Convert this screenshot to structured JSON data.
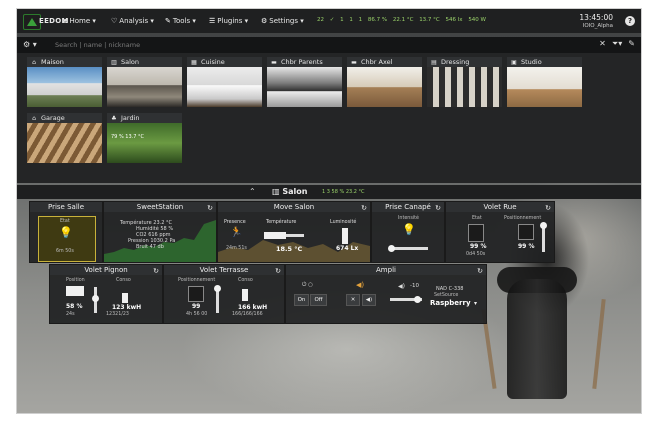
{
  "navbar": {
    "logo_text": "EEDOM",
    "items": [
      {
        "icon": "home-icon",
        "label": "Home ▾"
      },
      {
        "icon": "analysis-icon",
        "label": "Analysis ▾"
      },
      {
        "icon": "tools-icon",
        "label": "Tools ▾"
      },
      {
        "icon": "plugins-icon",
        "label": "Plugins ▾"
      },
      {
        "icon": "settings-icon",
        "label": "Settings ▾"
      }
    ],
    "status_items": [
      "22",
      "✓",
      "1",
      "1",
      "1",
      "86.7 %",
      "22.1 °C",
      "13.7 °C",
      "546 lx",
      "540 W"
    ],
    "time": "13:45:00",
    "subtitle": "IOIO_Alpha"
  },
  "search": {
    "placeholder": "Search | name | nickname"
  },
  "rooms": [
    {
      "name": "Maison",
      "icon": "house-icon",
      "info": ""
    },
    {
      "name": "Salon",
      "icon": "sofa-icon",
      "info": ""
    },
    {
      "name": "Cuisine",
      "icon": "kitchen-icon",
      "info": ""
    },
    {
      "name": "Chbr Parents",
      "icon": "bed-icon",
      "info": ""
    },
    {
      "name": "Chbr Axel",
      "icon": "bed-icon",
      "info": ""
    },
    {
      "name": "Dressing",
      "icon": "dressing-icon",
      "info": ""
    },
    {
      "name": "Studio",
      "icon": "desk-icon",
      "info": ""
    },
    {
      "name": "Garage",
      "icon": "garage-icon",
      "info": ""
    },
    {
      "name": "Jardin",
      "icon": "tree-icon",
      "info": "79 %   13.7 °C"
    }
  ],
  "current_room": {
    "title": "Salon",
    "stats": "1  3  58 %  23.2 °C"
  },
  "widgets": {
    "prise_salle": {
      "title": "Prise Salle",
      "state_label": "Etat",
      "duration": "6m 50s"
    },
    "sweetstation": {
      "title": "SweetStation",
      "lines": [
        "Température 23.2 °C",
        "Humidité 58 %",
        "CO2 616 ppm",
        "Pression 1030.2 Pa",
        "Bruit 47 db"
      ]
    },
    "move_salon": {
      "title": "Move Salon",
      "presence_label": "Presence",
      "temperature_label": "Température",
      "luminosite_label": "Luminosité",
      "presence_value": "24m 51s",
      "temperature_value": "18.5 °C",
      "luminosite_value": "674 Lx"
    },
    "prise_canape": {
      "title": "Prise Canapé",
      "label": "Intensité"
    },
    "volet_rue": {
      "title": "Volet Rue",
      "etat_label": "Etat",
      "position_label": "Positionnement",
      "etat_value": "99 %",
      "position_value": "99 %",
      "sub": "0d4 50s"
    },
    "volet_pignon": {
      "title": "Volet Pignon",
      "position_label": "Position",
      "conso_label": "Conso",
      "position_value": "58 %",
      "conso_value": "123 kwH",
      "sub1": "24s",
      "sub2": "12321/23"
    },
    "volet_terrasse": {
      "title": "Volet Terrasse",
      "position_label": "Positionnement",
      "conso_label": "Conso",
      "position_value": "99",
      "conso_value": "166 kwH",
      "sub1": "4h 56 00",
      "sub2": "166/166/166"
    },
    "ampli": {
      "title": "Ampli",
      "power_label": "⏻ ○",
      "on_label": "On",
      "off_label": "Off",
      "mute_label": "✕",
      "vol_label": "◀)",
      "volume_value": "-10",
      "device": "NAD C-338",
      "source_label": "SetSource",
      "source_value": "Raspberry"
    }
  }
}
